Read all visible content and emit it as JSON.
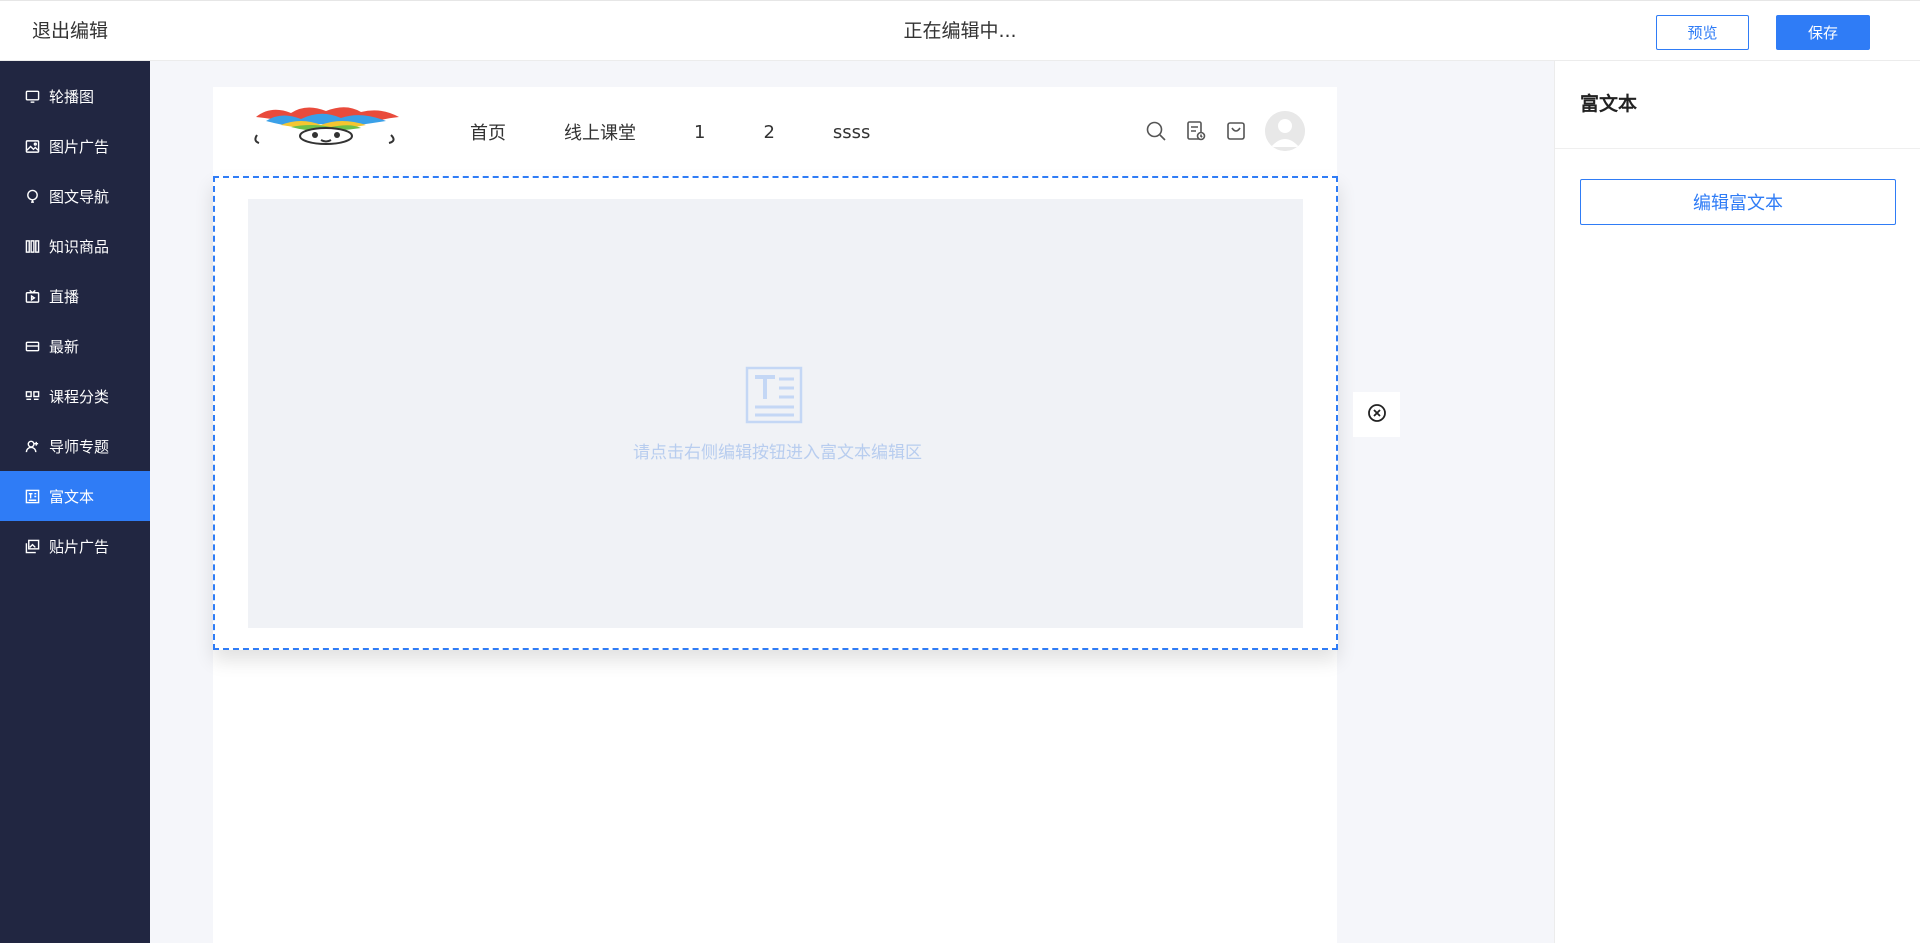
{
  "topbar": {
    "exit_label": "退出编辑",
    "status_text": "正在编辑中...",
    "preview_label": "预览",
    "save_label": "保存"
  },
  "sidebar": {
    "items": [
      {
        "label": "轮播图",
        "icon": "monitor-icon"
      },
      {
        "label": "图片广告",
        "icon": "image-icon"
      },
      {
        "label": "图文导航",
        "icon": "balloon-icon"
      },
      {
        "label": "知识商品",
        "icon": "books-icon"
      },
      {
        "label": "直播",
        "icon": "tv-icon"
      },
      {
        "label": "最新",
        "icon": "card-icon"
      },
      {
        "label": "课程分类",
        "icon": "category-icon"
      },
      {
        "label": "导师专题",
        "icon": "user-icon"
      },
      {
        "label": "富文本",
        "icon": "richtext-icon",
        "active": true
      },
      {
        "label": "贴片广告",
        "icon": "gallery-icon"
      }
    ]
  },
  "site": {
    "nav": [
      "首页",
      "线上课堂",
      "1",
      "2",
      "ssss"
    ]
  },
  "richtext": {
    "placeholder": "请点击右侧编辑按钮进入富文本编辑区"
  },
  "panel": {
    "title": "富文本",
    "edit_button": "编辑富文本"
  },
  "colors": {
    "accent": "#2f7cf6",
    "sidebar_bg": "#212641"
  }
}
